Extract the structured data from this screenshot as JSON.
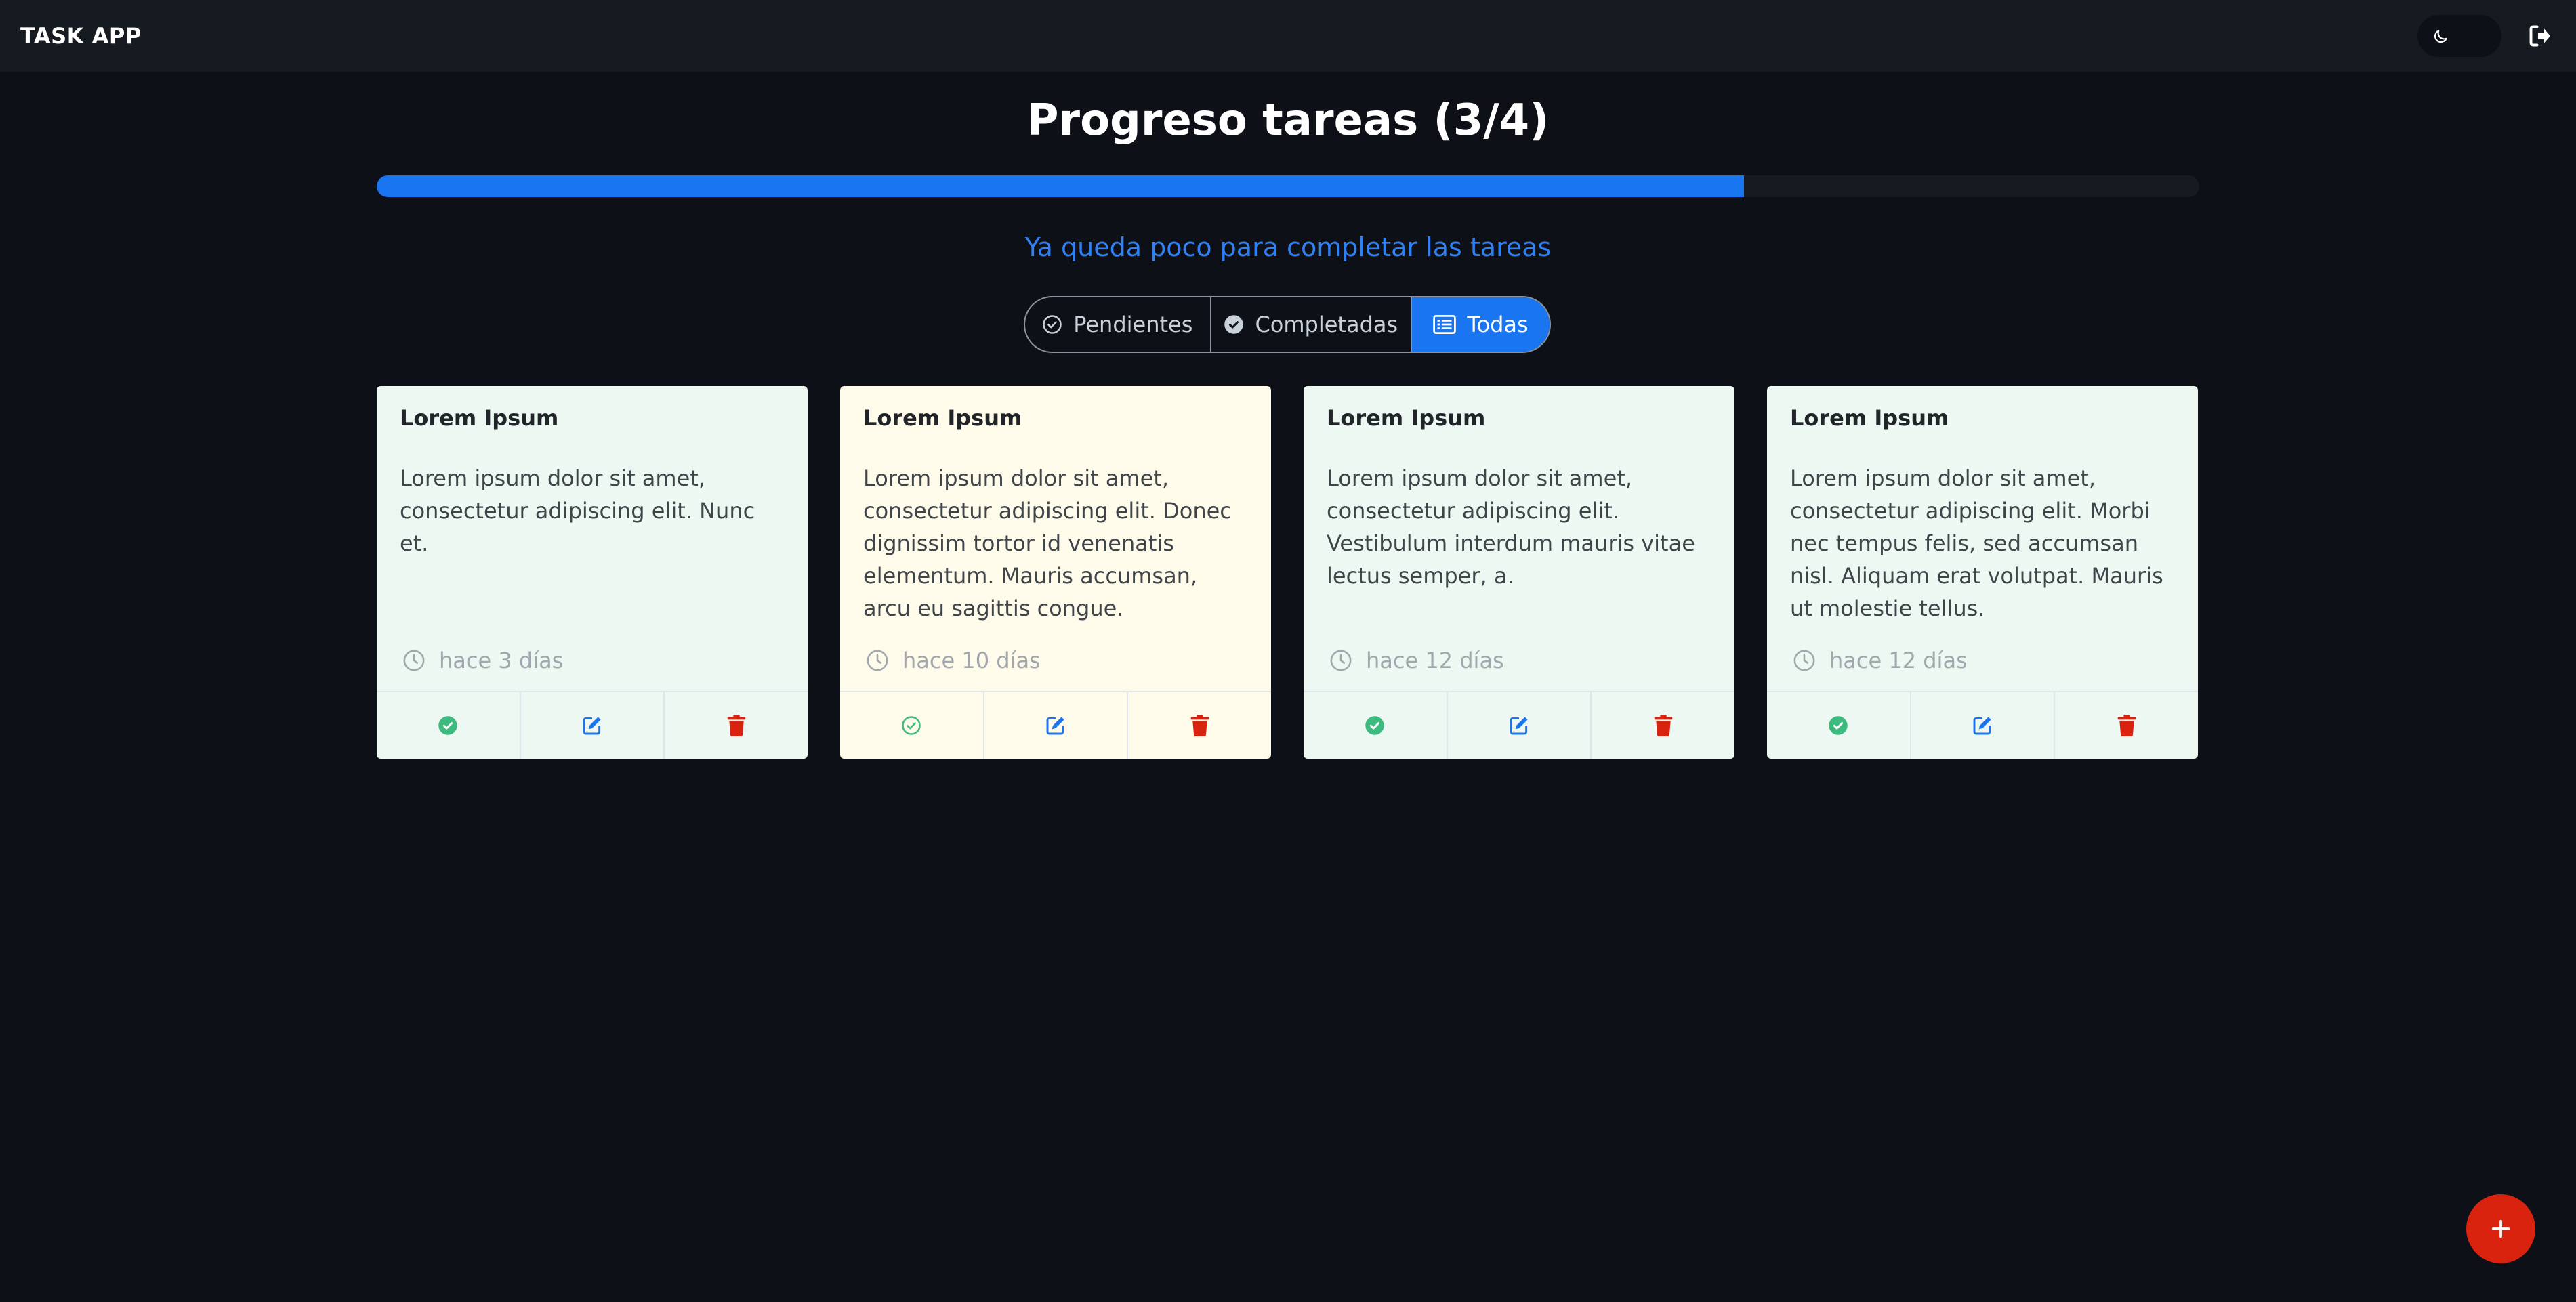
{
  "app": {
    "title": "TASK APP"
  },
  "header": {
    "theme_icon": "moon-icon",
    "logout_icon": "logout-icon"
  },
  "progress": {
    "title": "Progreso tareas (3/4)",
    "completed": 3,
    "total": 4,
    "fraction": 0.75,
    "message": "Ya queda poco para completar las tareas",
    "bar_color": "#1a75f0"
  },
  "filters": [
    {
      "label": "Pendientes",
      "icon": "check-circle-outline-icon",
      "active": false
    },
    {
      "label": "Completadas",
      "icon": "check-circle-filled-icon",
      "active": false
    },
    {
      "label": "Todas",
      "icon": "list-icon",
      "active": true
    }
  ],
  "tasks": [
    {
      "title": "Lorem Ipsum",
      "description": "Lorem ipsum dolor sit amet, consectetur adipiscing elit. Nunc et.",
      "time": "hace 3 días",
      "completed": true
    },
    {
      "title": "Lorem Ipsum",
      "description": "Lorem ipsum dolor sit amet, consectetur adipiscing elit. Donec dignissim tortor id venenatis elementum. Mauris accumsan, arcu eu sagittis congue.",
      "time": "hace 10 días",
      "completed": false
    },
    {
      "title": "Lorem Ipsum",
      "description": "Lorem ipsum dolor sit amet, consectetur adipiscing elit. Vestibulum interdum mauris vitae lectus semper, a.",
      "time": "hace 12 días",
      "completed": true
    },
    {
      "title": "Lorem Ipsum",
      "description": "Lorem ipsum dolor sit amet, consectetur adipiscing elit. Morbi nec tempus felis, sed accumsan nisl. Aliquam erat volutpat. Mauris ut molestie tellus.",
      "time": "hace 12 días",
      "completed": true
    }
  ],
  "colors": {
    "complete_green": "#3dba7e",
    "edit_blue": "#1a75f0",
    "delete_red": "#d9230f",
    "card_done_bg": "#eef8f3",
    "card_pending_bg": "#fffbea"
  },
  "fab": {
    "icon": "plus-icon"
  }
}
